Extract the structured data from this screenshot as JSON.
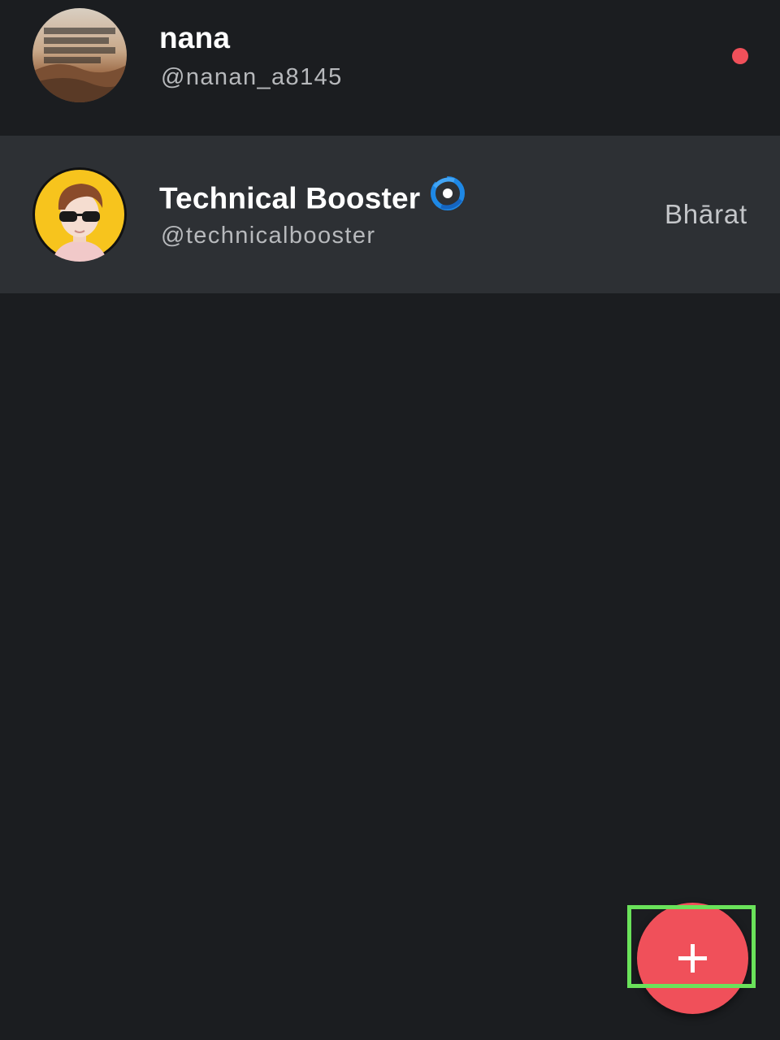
{
  "accounts": [
    {
      "name": "nana",
      "handle": "@nanan_a8145",
      "avatar_icon": "quote-landscape-avatar",
      "avatar_text": "Everything is possible. The impossible just takes longer.",
      "unread": true
    },
    {
      "name": "Technical Booster",
      "handle": "@technicalbooster",
      "avatar_icon": "cartoon-person-sunglasses-avatar",
      "verified_icon": "verified-swirl-icon",
      "region": "Bhārat",
      "selected": true
    }
  ],
  "fab": {
    "icon": "plus-icon"
  },
  "colors": {
    "background": "#1b1d20",
    "selected_row": "#2d3034",
    "accent": "#f0505a",
    "highlight": "#6ae25a",
    "verified": "#1e88e5"
  }
}
